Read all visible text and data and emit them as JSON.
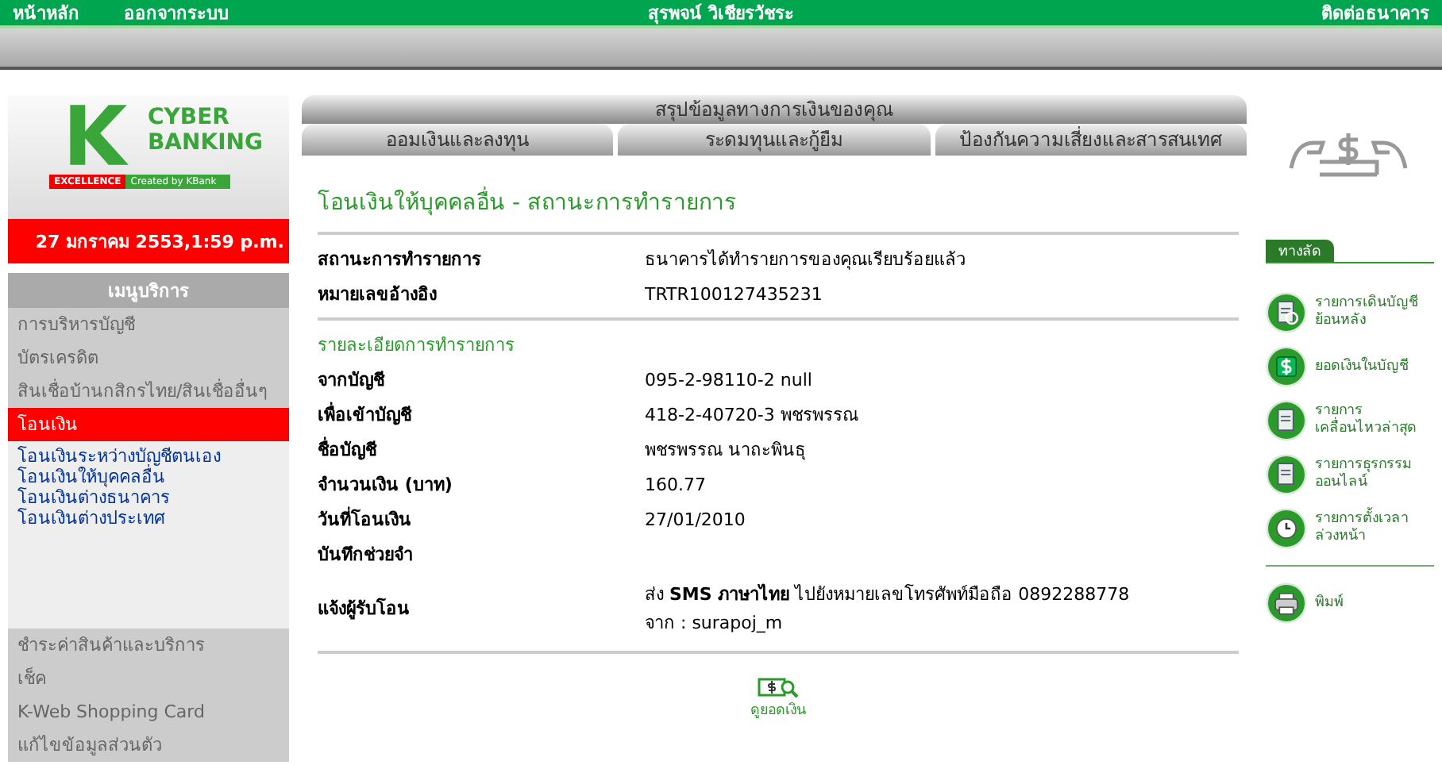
{
  "top_bar": {
    "left_links": [
      "หน้าหลัก",
      "ออกจากระบบ"
    ],
    "user_name": "สุรพจน์ วิเชียรวัชระ",
    "right_link": "ติดต่อธนาคาร"
  },
  "logo": {
    "line1": "CYBER",
    "line2": "BANKING",
    "badge": "EXCELLENCE",
    "tagline": "Created by KBank"
  },
  "date_time": "27 มกราคม 2553,1:59 p.m.",
  "menu": {
    "title": "เมนูบริการ",
    "items": [
      {
        "label": "การบริหารบัญชี",
        "selected": false
      },
      {
        "label": "บัตรเครดิต",
        "selected": false
      },
      {
        "label": "สินเชื่อบ้านกสิกรไทย/สินเชื่ออื่นๆ",
        "selected": false
      },
      {
        "label": "โอนเงิน",
        "selected": true,
        "children": [
          "โอนเงินระหว่างบัญชีตนเอง",
          "โอนเงินให้บุคคลอื่น",
          "โอนเงินต่างธนาคาร",
          "โอนเงินต่างประเทศ"
        ]
      },
      {
        "label": "ชำระค่าสินค้าและบริการ",
        "selected": false
      },
      {
        "label": "เช็ค",
        "selected": false
      },
      {
        "label": "K-Web Shopping Card",
        "selected": false
      },
      {
        "label": "แก้ไขข้อมูลส่วนตัว",
        "selected": false
      }
    ]
  },
  "tabs": {
    "top": "สรุปข้อมูลทางการเงินของคุณ",
    "items": [
      "ออมเงินและลงทุน",
      "ระดมทุนและกู้ยืม",
      "ป้องกันความเสี่ยงและสารสนเทศ"
    ]
  },
  "page_title": "โอนเงินให้บุคคลอื่น - สถานะการทำรายการ",
  "status_rows": [
    {
      "label": "สถานะการทำรายการ",
      "value": "ธนาคารได้ทำรายการของคุณเรียบร้อยแล้ว"
    },
    {
      "label": "หมายเลขอ้างอิง",
      "value": "TRTR100127435231"
    }
  ],
  "details_title": "รายละเอียดการทำรายการ",
  "detail_rows": [
    {
      "label": "จากบัญชี",
      "value": "095-2-98110-2 null"
    },
    {
      "label": "เพื่อเข้าบัญชี",
      "value": "418-2-40720-3 พชรพรรณ"
    },
    {
      "label": "ชื่อบัญชี",
      "value": "พชรพรรณ นาถะพินธุ"
    },
    {
      "label": "จำนวนเงิน (บาท)",
      "value": "160.77"
    },
    {
      "label": "วันที่โอนเงิน",
      "value": "27/01/2010"
    },
    {
      "label": "บันทึกช่วยจำ"
    },
    {
      "label": "แจ้งผู้รับโอน",
      "lines": [
        "ส่ง **SMS ภาษาไทย** ไปยังหมายเลขโทรศัพท์มือถือ 0892288778",
        "จาก : surapoj_m"
      ]
    }
  ],
  "balance_link": "ดูยอดเงิน",
  "shortcuts": {
    "title": "ทางลัด",
    "items": [
      {
        "kind": "history",
        "label": "รายการเดินบัญชีย้อนหลัง"
      },
      {
        "kind": "balance",
        "label": "ยอดเงินในบัญชี"
      },
      {
        "kind": "statement",
        "label": "รายการเคลื่อนไหวล่าสุด"
      },
      {
        "kind": "online",
        "label": "รายการธุรกรรมออนไลน์"
      },
      {
        "kind": "scheduled",
        "label": "รายการตั้งเวลาล่วงหน้า"
      }
    ],
    "print": {
      "kind": "print",
      "label": "พิมพ์"
    }
  }
}
